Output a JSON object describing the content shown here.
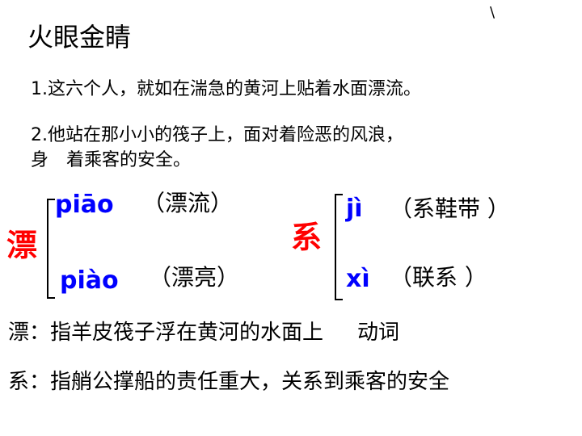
{
  "title": "火眼金睛",
  "tick_mark": "\\",
  "sentences": {
    "s1": "1.这六个人，就如在湍急的黄河上贴着水面漂流。",
    "s2_line1": "2.他站在那小小的筏子上，面对着险恶的风浪，",
    "s2_line2_start": "身",
    "s2_line2_end": "着乘客的安全。"
  },
  "piao": {
    "char": "漂",
    "reading1": {
      "pinyin": "piāo",
      "word": "（漂流）"
    },
    "reading2": {
      "pinyin": "piào",
      "word": "（漂亮）"
    }
  },
  "xi": {
    "char": "系",
    "reading1": {
      "pinyin": "jì",
      "word": "（系鞋带 ）"
    },
    "reading2": {
      "pinyin": "xì",
      "word": "（联系 ）"
    }
  },
  "explanations": {
    "piao": "漂：指羊皮筏子浮在黄河的水面上",
    "piao_pos": "动词",
    "xi": "系：指艄公撑船的责任重大，关系到乘客的安全"
  },
  "colors": {
    "char_accent": "#ff0000",
    "pinyin": "#0000ff"
  }
}
